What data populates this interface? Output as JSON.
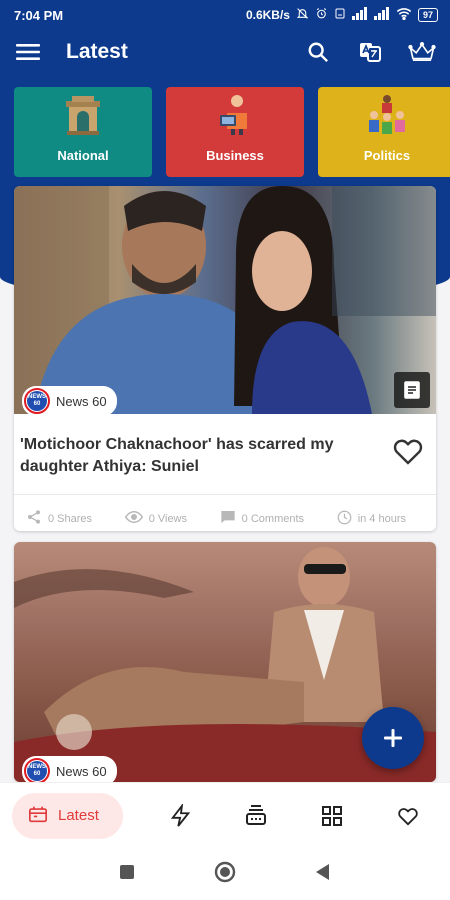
{
  "status": {
    "time": "7:04 PM",
    "speed": "0.6KB/s",
    "battery": "97"
  },
  "app_bar": {
    "title": "Latest"
  },
  "categories": [
    {
      "label": "National",
      "color": "#0f8b84"
    },
    {
      "label": "Business",
      "color": "#d33a3a"
    },
    {
      "label": "Politics",
      "color": "#ddb21b"
    }
  ],
  "cards": [
    {
      "source": "News 60",
      "headline": "'Motichoor Chaknachoor' has scarred my daughter Athiya: Suniel",
      "shares": "0 Shares",
      "views": "0 Views",
      "comments": "0 Comments",
      "time": "in 4 hours"
    },
    {
      "source": "News 60"
    }
  ],
  "source_logo": {
    "line1": "NEWS",
    "line2": "60"
  },
  "bottom_nav": {
    "active_label": "Latest"
  },
  "colors": {
    "primary": "#0d3a8c",
    "accent": "#e13a3a"
  }
}
